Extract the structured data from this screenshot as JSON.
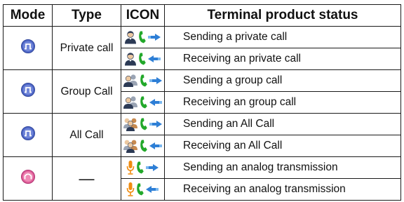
{
  "headers": {
    "mode": "Mode",
    "type": "Type",
    "icon": "ICON",
    "status": "Terminal product status"
  },
  "groups": [
    {
      "mode_icon": "digital-mode-icon",
      "mode_color": "#5068c8",
      "type": "Private call",
      "rows": [
        {
          "status": "Sending a private call",
          "icon": "private-call-send-icon",
          "party": "person",
          "direction": "send"
        },
        {
          "status": "Receiving an private call",
          "icon": "private-call-receive-icon",
          "party": "person",
          "direction": "receive"
        }
      ]
    },
    {
      "mode_icon": "digital-mode-icon",
      "mode_color": "#5068c8",
      "type": "Group Call",
      "rows": [
        {
          "status": "Sending a group call",
          "icon": "group-call-send-icon",
          "party": "group",
          "direction": "send"
        },
        {
          "status": "Receiving an group call",
          "icon": "group-call-receive-icon",
          "party": "group",
          "direction": "receive"
        }
      ]
    },
    {
      "mode_icon": "digital-mode-icon",
      "mode_color": "#5068c8",
      "type": "All Call",
      "rows": [
        {
          "status": "Sending an All Call",
          "icon": "all-call-send-icon",
          "party": "all",
          "direction": "send"
        },
        {
          "status": "Receiving an All Call",
          "icon": "all-call-receive-icon",
          "party": "all",
          "direction": "receive"
        }
      ]
    },
    {
      "mode_icon": "analog-mode-icon",
      "mode_color": "#e0609a",
      "type": "—",
      "rows": [
        {
          "status": "Sending an analog transmission",
          "icon": "analog-send-icon",
          "party": "mic",
          "direction": "send"
        },
        {
          "status": "Receiving an analog transmission",
          "icon": "analog-receive-icon",
          "party": "mic",
          "direction": "receive"
        }
      ]
    }
  ],
  "colors": {
    "phone": "#22a82a",
    "arrow": "#2e7fd6",
    "mic": "#f08c10",
    "person_dark": "#2c3a55",
    "person_light": "#9aa4b4",
    "person_warm": "#c88a50"
  }
}
